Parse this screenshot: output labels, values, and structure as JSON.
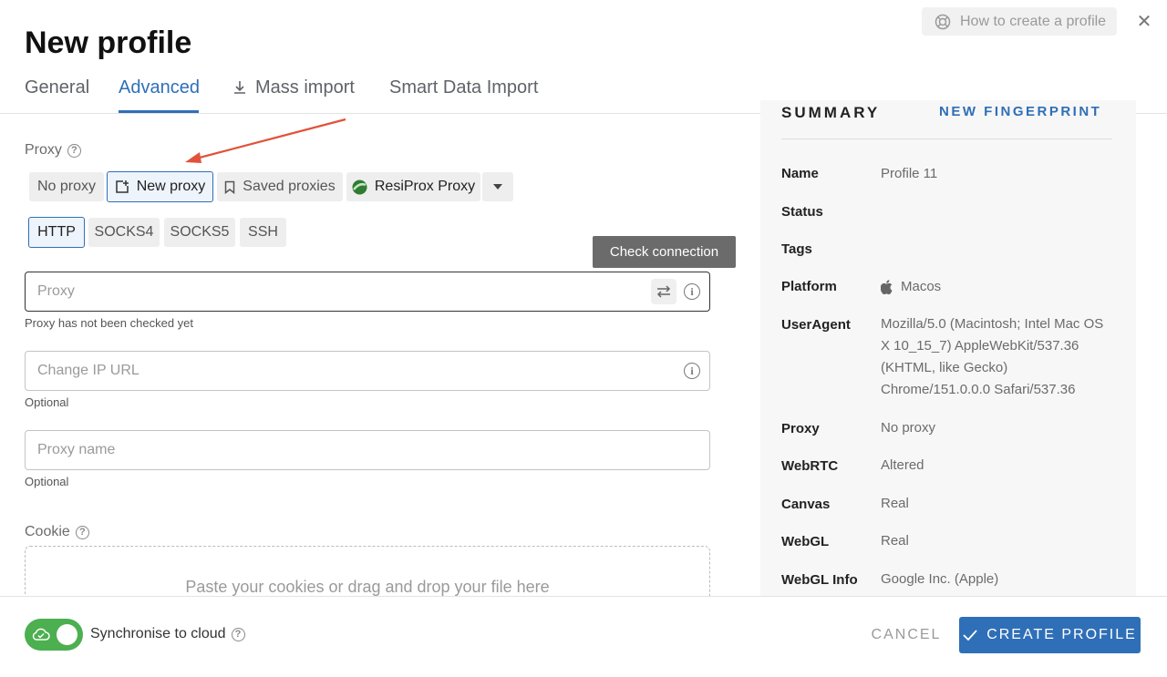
{
  "header": {
    "title": "New profile",
    "help_link": "How to create a profile",
    "tabs": [
      {
        "label": "General"
      },
      {
        "label": "Advanced"
      },
      {
        "label": "Mass import"
      },
      {
        "label": "Smart Data Import"
      }
    ],
    "active_tab": "Advanced"
  },
  "proxy": {
    "section_label": "Proxy",
    "source_options": [
      "No proxy",
      "New proxy",
      "Saved proxies",
      "ResiProx Proxy"
    ],
    "selected_source": "New proxy",
    "types": [
      "HTTP",
      "SOCKS4",
      "SOCKS5",
      "SSH"
    ],
    "selected_type": "HTTP",
    "tooltip": "Check connection",
    "proxy_input": {
      "placeholder": "Proxy",
      "value": "",
      "helper": "Proxy has not been checked yet"
    },
    "change_ip_input": {
      "placeholder": "Change IP URL",
      "value": "",
      "helper": "Optional"
    },
    "proxy_name_input": {
      "placeholder": "Proxy name",
      "value": "",
      "helper": "Optional"
    }
  },
  "cookie": {
    "section_label": "Cookie",
    "drop_text": "Paste your cookies or drag and drop your file here"
  },
  "summary": {
    "title": "SUMMARY",
    "new_fingerprint": "NEW FINGERPRINT",
    "rows": [
      {
        "key": "Name",
        "value": "Profile 11"
      },
      {
        "key": "Status",
        "value": ""
      },
      {
        "key": "Tags",
        "value": ""
      },
      {
        "key": "Platform",
        "value": "Macos"
      },
      {
        "key": "UserAgent",
        "value": "Mozilla/5.0 (Macintosh; Intel Mac OS X 10_15_7) AppleWebKit/537.36 (KHTML, like Gecko) Chrome/151.0.0.0 Safari/537.36"
      },
      {
        "key": "Proxy",
        "value": "No proxy"
      },
      {
        "key": "WebRTC",
        "value": "Altered"
      },
      {
        "key": "Canvas",
        "value": "Real"
      },
      {
        "key": "WebGL",
        "value": "Real"
      },
      {
        "key": "WebGL Info",
        "value": "Google Inc. (Apple)"
      }
    ]
  },
  "footer": {
    "sync_label": "Synchronise to cloud",
    "sync_enabled": true,
    "cancel_label": "CANCEL",
    "create_label": "CREATE PROFILE"
  },
  "colors": {
    "accent": "#2f6fb7",
    "toggle_on": "#4caf50",
    "annotation_arrow": "#e0533a"
  }
}
